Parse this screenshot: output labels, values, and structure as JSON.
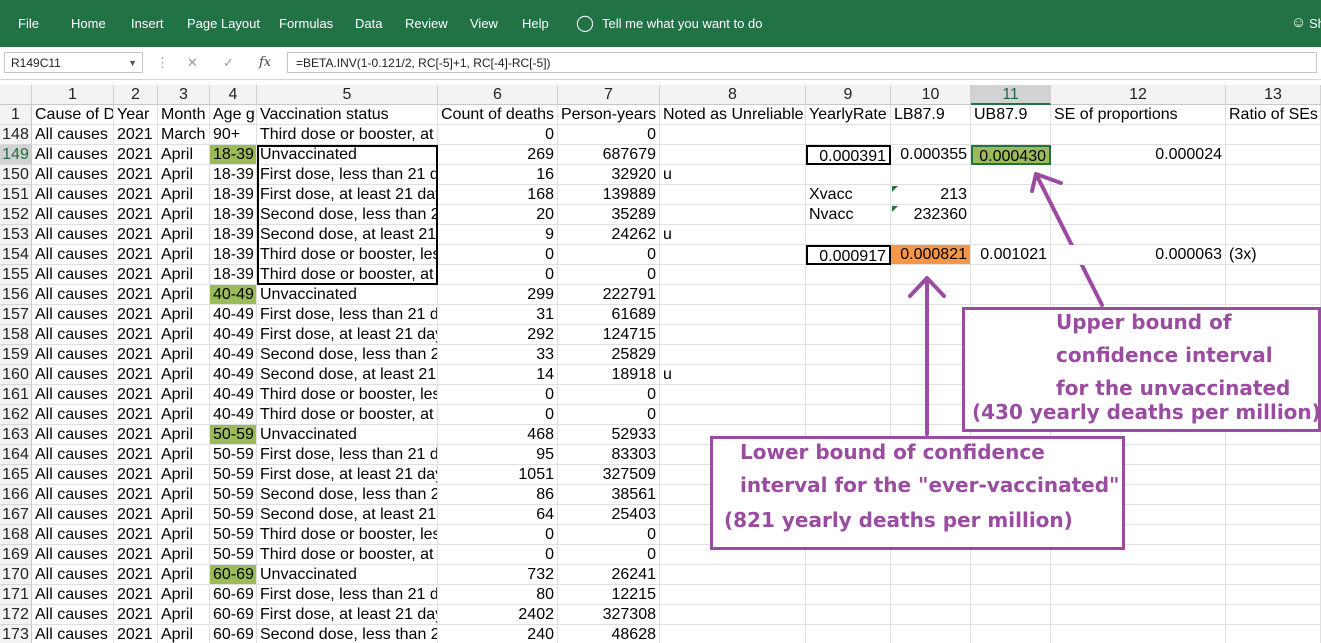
{
  "ribbon": {
    "tabs": [
      "File",
      "Home",
      "Insert",
      "Page Layout",
      "Formulas",
      "Data",
      "Review",
      "View",
      "Help"
    ],
    "tell_me": "Tell me what you want to do",
    "share_partial": "Sh"
  },
  "formula_bar": {
    "name_box": "R149C11",
    "formula": "=BETA.INV(1-0.121/2, RC[-5]+1, RC[-4]-RC[-5])"
  },
  "columns": [
    "1",
    "2",
    "3",
    "4",
    "5",
    "6",
    "7",
    "8",
    "9",
    "10",
    "11",
    "12",
    "13"
  ],
  "header_row": {
    "row": "1",
    "cells": [
      "Cause of D",
      "Year",
      "Month",
      "Age g",
      "Vaccination status",
      "Count of deaths",
      "Person-years",
      "Noted as Unreliable",
      "YearlyRate",
      "LB87.9",
      "UB87.9",
      "SE of proportions",
      "Ratio of SEs"
    ]
  },
  "rows": [
    {
      "row": "148",
      "cause": "All causes",
      "year": "2021",
      "month": "March",
      "age": "90+",
      "status": "Third dose or booster, at l",
      "deaths": "0",
      "py": "0",
      "unrel": ""
    },
    {
      "row": "149",
      "cause": "All causes",
      "year": "2021",
      "month": "April",
      "age": "18-39",
      "status": "Unvaccinated",
      "deaths": "269",
      "py": "687679",
      "unrel": ""
    },
    {
      "row": "150",
      "cause": "All causes",
      "year": "2021",
      "month": "April",
      "age": "18-39",
      "status": "First dose, less than 21 da",
      "deaths": "16",
      "py": "32920",
      "unrel": "u"
    },
    {
      "row": "151",
      "cause": "All causes",
      "year": "2021",
      "month": "April",
      "age": "18-39",
      "status": "First dose, at least 21 day",
      "deaths": "168",
      "py": "139889",
      "unrel": ""
    },
    {
      "row": "152",
      "cause": "All causes",
      "year": "2021",
      "month": "April",
      "age": "18-39",
      "status": "Second dose, less than 2",
      "deaths": "20",
      "py": "35289",
      "unrel": ""
    },
    {
      "row": "153",
      "cause": "All causes",
      "year": "2021",
      "month": "April",
      "age": "18-39",
      "status": "Second dose, at least 21",
      "deaths": "9",
      "py": "24262",
      "unrel": "u"
    },
    {
      "row": "154",
      "cause": "All causes",
      "year": "2021",
      "month": "April",
      "age": "18-39",
      "status": "Third dose or booster, les",
      "deaths": "0",
      "py": "0",
      "unrel": ""
    },
    {
      "row": "155",
      "cause": "All causes",
      "year": "2021",
      "month": "April",
      "age": "18-39",
      "status": "Third dose or booster, at l",
      "deaths": "0",
      "py": "0",
      "unrel": ""
    },
    {
      "row": "156",
      "cause": "All causes",
      "year": "2021",
      "month": "April",
      "age": "40-49",
      "status": "Unvaccinated",
      "deaths": "299",
      "py": "222791",
      "unrel": ""
    },
    {
      "row": "157",
      "cause": "All causes",
      "year": "2021",
      "month": "April",
      "age": "40-49",
      "status": "First dose, less than 21 da",
      "deaths": "31",
      "py": "61689",
      "unrel": ""
    },
    {
      "row": "158",
      "cause": "All causes",
      "year": "2021",
      "month": "April",
      "age": "40-49",
      "status": "First dose, at least 21 day",
      "deaths": "292",
      "py": "124715",
      "unrel": ""
    },
    {
      "row": "159",
      "cause": "All causes",
      "year": "2021",
      "month": "April",
      "age": "40-49",
      "status": "Second dose, less than 2",
      "deaths": "33",
      "py": "25829",
      "unrel": ""
    },
    {
      "row": "160",
      "cause": "All causes",
      "year": "2021",
      "month": "April",
      "age": "40-49",
      "status": "Second dose, at least 21",
      "deaths": "14",
      "py": "18918",
      "unrel": "u"
    },
    {
      "row": "161",
      "cause": "All causes",
      "year": "2021",
      "month": "April",
      "age": "40-49",
      "status": "Third dose or booster, les",
      "deaths": "0",
      "py": "0",
      "unrel": ""
    },
    {
      "row": "162",
      "cause": "All causes",
      "year": "2021",
      "month": "April",
      "age": "40-49",
      "status": "Third dose or booster, at l",
      "deaths": "0",
      "py": "0",
      "unrel": ""
    },
    {
      "row": "163",
      "cause": "All causes",
      "year": "2021",
      "month": "April",
      "age": "50-59",
      "status": "Unvaccinated",
      "deaths": "468",
      "py": "52933",
      "unrel": ""
    },
    {
      "row": "164",
      "cause": "All causes",
      "year": "2021",
      "month": "April",
      "age": "50-59",
      "status": "First dose, less than 21 da",
      "deaths": "95",
      "py": "83303",
      "unrel": ""
    },
    {
      "row": "165",
      "cause": "All causes",
      "year": "2021",
      "month": "April",
      "age": "50-59",
      "status": "First dose, at least 21 day",
      "deaths": "1051",
      "py": "327509",
      "unrel": ""
    },
    {
      "row": "166",
      "cause": "All causes",
      "year": "2021",
      "month": "April",
      "age": "50-59",
      "status": "Second dose, less than 2",
      "deaths": "86",
      "py": "38561",
      "unrel": ""
    },
    {
      "row": "167",
      "cause": "All causes",
      "year": "2021",
      "month": "April",
      "age": "50-59",
      "status": "Second dose, at least 21",
      "deaths": "64",
      "py": "25403",
      "unrel": ""
    },
    {
      "row": "168",
      "cause": "All causes",
      "year": "2021",
      "month": "April",
      "age": "50-59",
      "status": "Third dose or booster, les",
      "deaths": "0",
      "py": "0",
      "unrel": ""
    },
    {
      "row": "169",
      "cause": "All causes",
      "year": "2021",
      "month": "April",
      "age": "50-59",
      "status": "Third dose or booster, at l",
      "deaths": "0",
      "py": "0",
      "unrel": ""
    },
    {
      "row": "170",
      "cause": "All causes",
      "year": "2021",
      "month": "April",
      "age": "60-69",
      "status": "Unvaccinated",
      "deaths": "732",
      "py": "26241",
      "unrel": ""
    },
    {
      "row": "171",
      "cause": "All causes",
      "year": "2021",
      "month": "April",
      "age": "60-69",
      "status": "First dose, less than 21 da",
      "deaths": "80",
      "py": "12215",
      "unrel": ""
    },
    {
      "row": "172",
      "cause": "All causes",
      "year": "2021",
      "month": "April",
      "age": "60-69",
      "status": "First dose, at least 21 day",
      "deaths": "2402",
      "py": "327308",
      "unrel": ""
    },
    {
      "row": "173",
      "cause": "All causes",
      "year": "2021",
      "month": "April",
      "age": "60-69",
      "status": "Second dose, less than 2",
      "deaths": "240",
      "py": "48628",
      "unrel": ""
    }
  ],
  "stats": {
    "r149": {
      "rate": "0.000391",
      "lb": "0.000355",
      "ub": "0.000430",
      "se": "0.000024"
    },
    "r151": {
      "label": "Xvacc",
      "value": "213"
    },
    "r152": {
      "label": "Nvacc",
      "value": "232360"
    },
    "r154": {
      "rate": "0.000917",
      "lb": "0.000821",
      "ub": "0.001021",
      "se": "0.000063",
      "ratio": "(3x)"
    }
  },
  "highlight_colors": {
    "age_green": "#9bbb59",
    "lb_orange": "#f79646",
    "annotation_purple": "#9a4ca0",
    "ribbon_green": "#217346"
  },
  "annotations": {
    "upper": [
      "Upper bound of",
      "confidence interval",
      "for the unvaccinated",
      "(430 yearly deaths per million)"
    ],
    "lower": [
      "Lower bound of confidence",
      "interval for the \"ever-vaccinated\"",
      "(821 yearly deaths per million)"
    ]
  },
  "icons": [
    "lightbulb-icon",
    "user-icon",
    "dropdown-caret-icon",
    "cancel-x-icon",
    "enter-check-icon",
    "function-fx-icon",
    "more-dots-icon"
  ]
}
